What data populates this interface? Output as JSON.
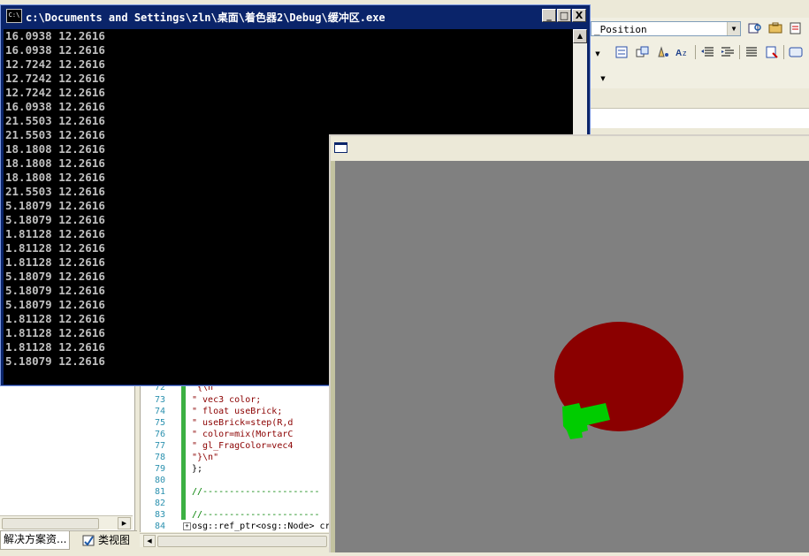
{
  "ide": {
    "toolbar_combo_value": "_Position",
    "solution_tabs": [
      {
        "label": "解决方案资..."
      },
      {
        "label": "类视图"
      }
    ],
    "code_lines": [
      {
        "num": "72",
        "text": "\"{\\n\""
      },
      {
        "num": "73",
        "text": "\"    vec3 color;"
      },
      {
        "num": "74",
        "text": "\"    float useBrick;"
      },
      {
        "num": "75",
        "text": "\"    useBrick=step(R,d"
      },
      {
        "num": "76",
        "text": "\"    color=mix(MortarC"
      },
      {
        "num": "77",
        "text": "\"    gl_FragColor=vec4"
      },
      {
        "num": "78",
        "text": "\"}\\n\""
      },
      {
        "num": "79",
        "text": "};"
      },
      {
        "num": "80",
        "text": ""
      },
      {
        "num": "81",
        "text": "//----------------------"
      },
      {
        "num": "82",
        "text": ""
      },
      {
        "num": "83",
        "text": "//----------------------"
      },
      {
        "num": "84",
        "text": "osg::ref_ptr<osg::Node> cr"
      }
    ]
  },
  "console": {
    "title": "c:\\Documents and Settings\\zln\\桌面\\着色器2\\Debug\\缓冲区.exe",
    "icon_label": "C:\\",
    "buttons": {
      "minimize": "_",
      "maximize": "□",
      "close": "X"
    },
    "lines": [
      "16.0938 12.2616",
      "16.0938 12.2616",
      "12.7242 12.2616",
      "12.7242 12.2616",
      "12.7242 12.2616",
      "16.0938 12.2616",
      "21.5503 12.2616",
      "21.5503 12.2616",
      "18.1808 12.2616",
      "18.1808 12.2616",
      "18.1808 12.2616",
      "21.5503 12.2616",
      "5.18079 12.2616",
      "5.18079 12.2616",
      "1.81128 12.2616",
      "1.81128 12.2616",
      "1.81128 12.2616",
      "5.18079 12.2616",
      "5.18079 12.2616",
      "5.18079 12.2616",
      "1.81128 12.2616",
      "1.81128 12.2616",
      "1.81128 12.2616",
      "5.18079 12.2616"
    ]
  },
  "viewer": {
    "background_color": "#808080",
    "ellipse_color": "#8B0000",
    "shape_color": "#00CC00"
  }
}
